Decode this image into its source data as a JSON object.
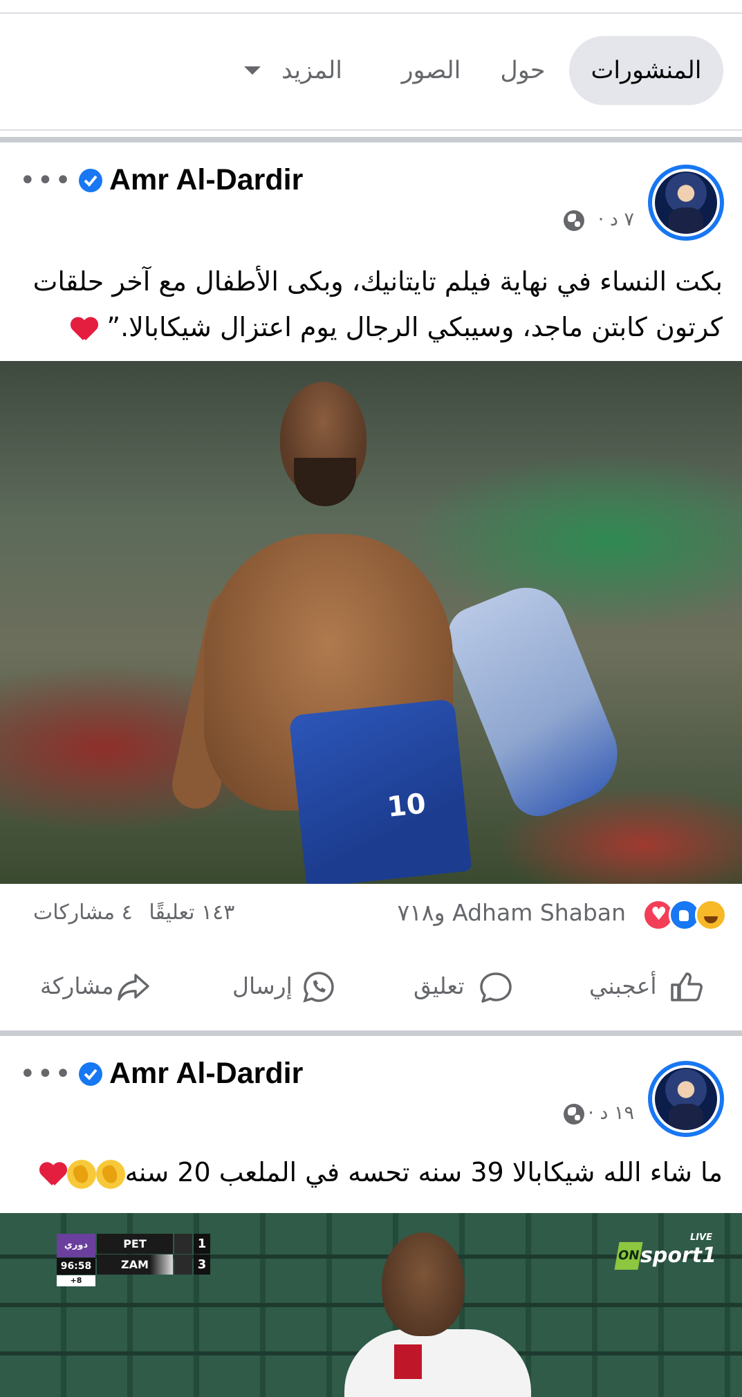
{
  "tabs": {
    "posts": "المنشورات",
    "about": "حول",
    "photos": "الصور",
    "more": "المزيد",
    "more_icon": "caret-down-icon"
  },
  "posts": [
    {
      "author": "Amr Al-Dardir",
      "verified_icon": "verified-badge-icon",
      "options_label": "•••",
      "time": "٧ د ·",
      "privacy_icon": "globe-icon",
      "text_line1": "بكت النساء في نهاية فيلم تايتانيك، وبكى الأطفال مع آخر حلقات",
      "text_line2": "كرتون كابتن ماجد، وسيبكي الرجال يوم اعتزال شيكابالا.”",
      "reactions": {
        "types": [
          "haha",
          "like",
          "love"
        ],
        "summary": "Adham Shaban و٧١٨",
        "comments": "١٤٣ تعليقًا",
        "shares": "٤ مشاركات"
      },
      "actions": {
        "like": "أعجبني",
        "comment": "تعليق",
        "send": "إرسال",
        "share": "مشاركة"
      }
    },
    {
      "author": "Amr Al-Dardir",
      "verified_icon": "verified-badge-icon",
      "options_label": "•••",
      "time": "١٩ د ·",
      "privacy_icon": "globe-icon",
      "text": "ما شاء الله شيكابالا 39 سنه تحسه في الملعب 20 سنه",
      "scoreboard": {
        "league_logo": "دوري NILE",
        "time": "96:58",
        "added": "+8",
        "team1": "PET",
        "score1": "1",
        "team2": "ZAM",
        "score2": "3"
      },
      "broadcaster": {
        "live": "LIVE",
        "on": "ON",
        "sport": "sport1"
      }
    }
  ],
  "colors": {
    "accent": "#1877f2",
    "secondary_text": "#65676b",
    "tab_active_bg": "#e4e6eb",
    "love": "#f33e58",
    "heart": "#e41e3f"
  }
}
